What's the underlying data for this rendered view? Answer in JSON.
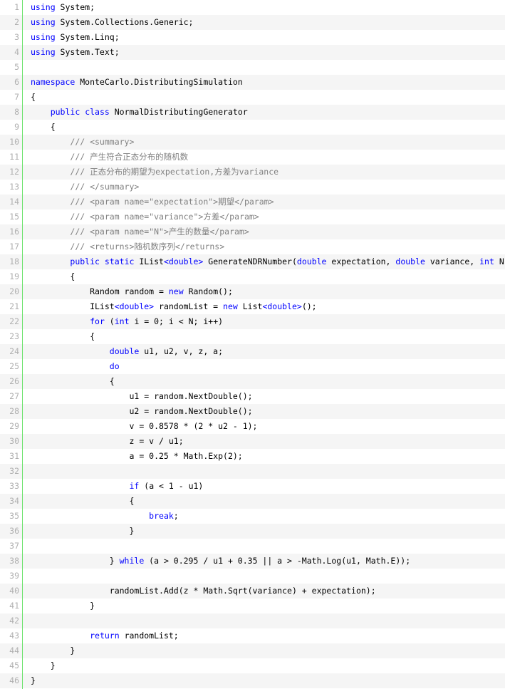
{
  "code": {
    "language": "C#",
    "lines": [
      {
        "number": "1",
        "tokens": [
          {
            "t": "using",
            "c": "keyword"
          },
          {
            "t": " System;",
            "c": "plain"
          }
        ]
      },
      {
        "number": "2",
        "tokens": [
          {
            "t": "using",
            "c": "keyword"
          },
          {
            "t": " System.Collections.Generic;",
            "c": "plain"
          }
        ]
      },
      {
        "number": "3",
        "tokens": [
          {
            "t": "using",
            "c": "keyword"
          },
          {
            "t": " System.Linq;",
            "c": "plain"
          }
        ]
      },
      {
        "number": "4",
        "tokens": [
          {
            "t": "using",
            "c": "keyword"
          },
          {
            "t": " System.Text;",
            "c": "plain"
          }
        ]
      },
      {
        "number": "5",
        "tokens": []
      },
      {
        "number": "6",
        "tokens": [
          {
            "t": "namespace",
            "c": "keyword"
          },
          {
            "t": " MonteCarlo.DistributingSimulation",
            "c": "plain"
          }
        ]
      },
      {
        "number": "7",
        "tokens": [
          {
            "t": "{",
            "c": "plain"
          }
        ]
      },
      {
        "number": "8",
        "tokens": [
          {
            "t": "    ",
            "c": "plain"
          },
          {
            "t": "public",
            "c": "keyword"
          },
          {
            "t": " ",
            "c": "plain"
          },
          {
            "t": "class",
            "c": "keyword"
          },
          {
            "t": " NormalDistributingGenerator",
            "c": "plain"
          }
        ]
      },
      {
        "number": "9",
        "tokens": [
          {
            "t": "    {",
            "c": "plain"
          }
        ]
      },
      {
        "number": "10",
        "tokens": [
          {
            "t": "        ",
            "c": "plain"
          },
          {
            "t": "/// <summary>",
            "c": "comment"
          }
        ]
      },
      {
        "number": "11",
        "tokens": [
          {
            "t": "        ",
            "c": "plain"
          },
          {
            "t": "/// 产生符合正态分布的随机数",
            "c": "comment"
          }
        ]
      },
      {
        "number": "12",
        "tokens": [
          {
            "t": "        ",
            "c": "plain"
          },
          {
            "t": "/// 正态分布的期望为expectation,方差为variance",
            "c": "comment"
          }
        ]
      },
      {
        "number": "13",
        "tokens": [
          {
            "t": "        ",
            "c": "plain"
          },
          {
            "t": "/// </summary>",
            "c": "comment"
          }
        ]
      },
      {
        "number": "14",
        "tokens": [
          {
            "t": "        ",
            "c": "plain"
          },
          {
            "t": "/// <param name=\"expectation\">期望</param>",
            "c": "comment"
          }
        ]
      },
      {
        "number": "15",
        "tokens": [
          {
            "t": "        ",
            "c": "plain"
          },
          {
            "t": "/// <param name=\"variance\">方差</param>",
            "c": "comment"
          }
        ]
      },
      {
        "number": "16",
        "tokens": [
          {
            "t": "        ",
            "c": "plain"
          },
          {
            "t": "/// <param name=\"N\">产生的数量</param>",
            "c": "comment"
          }
        ]
      },
      {
        "number": "17",
        "tokens": [
          {
            "t": "        ",
            "c": "plain"
          },
          {
            "t": "/// <returns>随机数序列</returns>",
            "c": "comment"
          }
        ]
      },
      {
        "number": "18",
        "tokens": [
          {
            "t": "        ",
            "c": "plain"
          },
          {
            "t": "public",
            "c": "keyword"
          },
          {
            "t": " ",
            "c": "plain"
          },
          {
            "t": "static",
            "c": "keyword"
          },
          {
            "t": " IList",
            "c": "plain"
          },
          {
            "t": "<double>",
            "c": "keyword"
          },
          {
            "t": " GenerateNDRNumber(",
            "c": "plain"
          },
          {
            "t": "double",
            "c": "keyword"
          },
          {
            "t": " expectation, ",
            "c": "plain"
          },
          {
            "t": "double",
            "c": "keyword"
          },
          {
            "t": " variance, ",
            "c": "plain"
          },
          {
            "t": "int",
            "c": "keyword"
          },
          {
            "t": " N)",
            "c": "plain"
          }
        ]
      },
      {
        "number": "19",
        "tokens": [
          {
            "t": "        {",
            "c": "plain"
          }
        ]
      },
      {
        "number": "20",
        "tokens": [
          {
            "t": "            Random random = ",
            "c": "plain"
          },
          {
            "t": "new",
            "c": "keyword"
          },
          {
            "t": " Random();",
            "c": "plain"
          }
        ]
      },
      {
        "number": "21",
        "tokens": [
          {
            "t": "            IList",
            "c": "plain"
          },
          {
            "t": "<double>",
            "c": "keyword"
          },
          {
            "t": " randomList = ",
            "c": "plain"
          },
          {
            "t": "new",
            "c": "keyword"
          },
          {
            "t": " List",
            "c": "plain"
          },
          {
            "t": "<double>",
            "c": "keyword"
          },
          {
            "t": "();",
            "c": "plain"
          }
        ]
      },
      {
        "number": "22",
        "tokens": [
          {
            "t": "            ",
            "c": "plain"
          },
          {
            "t": "for",
            "c": "keyword"
          },
          {
            "t": " (",
            "c": "plain"
          },
          {
            "t": "int",
            "c": "keyword"
          },
          {
            "t": " i = 0; i < N; i++)",
            "c": "plain"
          }
        ]
      },
      {
        "number": "23",
        "tokens": [
          {
            "t": "            {",
            "c": "plain"
          }
        ]
      },
      {
        "number": "24",
        "tokens": [
          {
            "t": "                ",
            "c": "plain"
          },
          {
            "t": "double",
            "c": "keyword"
          },
          {
            "t": " u1, u2, v, z, a;",
            "c": "plain"
          }
        ]
      },
      {
        "number": "25",
        "tokens": [
          {
            "t": "                ",
            "c": "plain"
          },
          {
            "t": "do",
            "c": "keyword"
          }
        ]
      },
      {
        "number": "26",
        "tokens": [
          {
            "t": "                {",
            "c": "plain"
          }
        ]
      },
      {
        "number": "27",
        "tokens": [
          {
            "t": "                    u1 = random.NextDouble();",
            "c": "plain"
          }
        ]
      },
      {
        "number": "28",
        "tokens": [
          {
            "t": "                    u2 = random.NextDouble();",
            "c": "plain"
          }
        ]
      },
      {
        "number": "29",
        "tokens": [
          {
            "t": "                    v = 0.8578 * (2 * u2 - 1);",
            "c": "plain"
          }
        ]
      },
      {
        "number": "30",
        "tokens": [
          {
            "t": "                    z = v / u1;",
            "c": "plain"
          }
        ]
      },
      {
        "number": "31",
        "tokens": [
          {
            "t": "                    a = 0.25 * Math.Exp(2);",
            "c": "plain"
          }
        ]
      },
      {
        "number": "32",
        "tokens": []
      },
      {
        "number": "33",
        "tokens": [
          {
            "t": "                    ",
            "c": "plain"
          },
          {
            "t": "if",
            "c": "keyword"
          },
          {
            "t": " (a < 1 - u1)",
            "c": "plain"
          }
        ]
      },
      {
        "number": "34",
        "tokens": [
          {
            "t": "                    {",
            "c": "plain"
          }
        ]
      },
      {
        "number": "35",
        "tokens": [
          {
            "t": "                        ",
            "c": "plain"
          },
          {
            "t": "break",
            "c": "keyword"
          },
          {
            "t": ";",
            "c": "plain"
          }
        ]
      },
      {
        "number": "36",
        "tokens": [
          {
            "t": "                    }",
            "c": "plain"
          }
        ]
      },
      {
        "number": "37",
        "tokens": []
      },
      {
        "number": "38",
        "tokens": [
          {
            "t": "                } ",
            "c": "plain"
          },
          {
            "t": "while",
            "c": "keyword"
          },
          {
            "t": " (a > 0.295 / u1 + 0.35 || a > -Math.Log(u1, Math.E));",
            "c": "plain"
          }
        ]
      },
      {
        "number": "39",
        "tokens": []
      },
      {
        "number": "40",
        "tokens": [
          {
            "t": "                randomList.Add(z * Math.Sqrt(variance) + expectation);",
            "c": "plain"
          }
        ]
      },
      {
        "number": "41",
        "tokens": [
          {
            "t": "            }",
            "c": "plain"
          }
        ]
      },
      {
        "number": "42",
        "tokens": []
      },
      {
        "number": "43",
        "tokens": [
          {
            "t": "            ",
            "c": "plain"
          },
          {
            "t": "return",
            "c": "keyword"
          },
          {
            "t": " randomList;",
            "c": "plain"
          }
        ]
      },
      {
        "number": "44",
        "tokens": [
          {
            "t": "        }",
            "c": "plain"
          }
        ]
      },
      {
        "number": "45",
        "tokens": [
          {
            "t": "    }",
            "c": "plain"
          }
        ]
      },
      {
        "number": "46",
        "tokens": [
          {
            "t": "}",
            "c": "plain"
          }
        ]
      }
    ]
  },
  "colors": {
    "keyword": "#0000ff",
    "comment": "#808080",
    "plain": "#000000",
    "line_number": "#afafaf",
    "gutter_border": "#6ce26c",
    "alt_row": "#f5f5f5"
  }
}
